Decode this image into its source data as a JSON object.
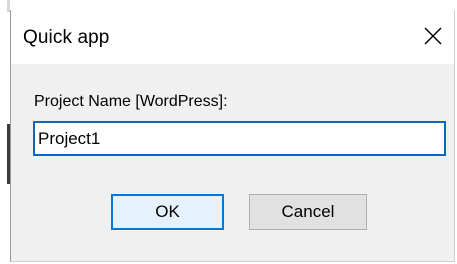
{
  "dialog": {
    "title": "Quick app",
    "prompt_label": "Project Name [WordPress]:",
    "input_value": "Project1",
    "ok_label": "OK",
    "cancel_label": "Cancel",
    "close_icon": "close-icon"
  },
  "colors": {
    "dialog_bg": "#f0f0f0",
    "titlebar_bg": "#ffffff",
    "accent": "#0078d7",
    "input_border": "#0a67c2"
  }
}
